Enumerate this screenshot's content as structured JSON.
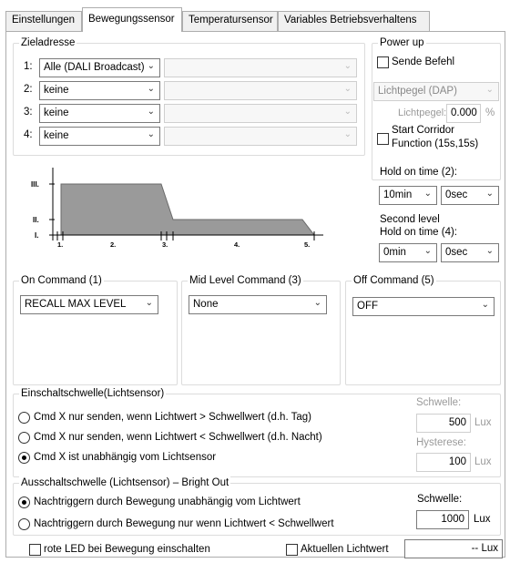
{
  "tabs": [
    {
      "label": "Einstellungen",
      "active": false
    },
    {
      "label": "Bewegungssensor",
      "active": true
    },
    {
      "label": "Temperatursensor",
      "active": false
    },
    {
      "label": "Variables Betriebsverhaltens",
      "active": false
    }
  ],
  "zieladresse": {
    "title": "Zieladresse",
    "rows": [
      {
        "index": "1:",
        "value": "Alle (DALI Broadcast)"
      },
      {
        "index": "2:",
        "value": "keine"
      },
      {
        "index": "3:",
        "value": "keine"
      },
      {
        "index": "4:",
        "value": "keine"
      }
    ]
  },
  "power_up": {
    "title": "Power up",
    "sende_befehl": "Sende Befehl",
    "lichtpegel_select": "Lichtpegel (DAP)",
    "lichtpegel_label": "Lichtpegel:",
    "lichtpegel_value": "0.000",
    "lichtpegel_unit": "%",
    "corridor_line1": "Start Corridor",
    "corridor_line2": "Function (15s,15s)"
  },
  "graph": {
    "level_labels": [
      "III.",
      "II.",
      "I."
    ],
    "phase_labels": [
      "1.",
      "2.",
      "3.",
      "4.",
      "5."
    ]
  },
  "hold_time": {
    "label": "Hold on time (2):",
    "min": "10min",
    "sec": "0sec",
    "second_level_line1": "Second level",
    "second_level_line2": "Hold on time (4):",
    "min2": "0min",
    "sec2": "0sec"
  },
  "on_command": {
    "title": "On Command (1)",
    "value": "RECALL MAX LEVEL"
  },
  "mid_command": {
    "title": "Mid Level Command (3)",
    "value": "None"
  },
  "off_command": {
    "title": "Off Command (5)",
    "value": "OFF"
  },
  "einschalt": {
    "title": "Einschaltschwelle(Lichtsensor)",
    "options": [
      {
        "label": "Cmd X nur senden, wenn Lichtwert > Schwellwert (d.h. Tag)",
        "selected": false
      },
      {
        "label": "Cmd X nur senden, wenn Lichtwert < Schwellwert (d.h. Nacht)",
        "selected": false
      },
      {
        "label": "Cmd X ist unabhängig vom Lichtsensor",
        "selected": true
      }
    ],
    "schwelle_label": "Schwelle:",
    "schwelle_value": "500",
    "schwelle_unit": "Lux",
    "hysterese_label": "Hysterese:",
    "hysterese_value": "100",
    "hysterese_unit": "Lux"
  },
  "ausschalt": {
    "title": "Ausschaltschwelle (Lichtsensor) – Bright Out",
    "options": [
      {
        "label": "Nachtriggern durch Bewegung unabhängig vom Lichtwert",
        "selected": true
      },
      {
        "label": "Nachtriggern durch Bewegung nur wenn Lichtwert < Schwellwert",
        "selected": false
      }
    ],
    "schwelle_label": "Schwelle:",
    "schwelle_value": "1000",
    "schwelle_unit": "Lux"
  },
  "bottom": {
    "rote_led": "rote LED bei Bewegung einschalten",
    "aktuellen": "Aktuellen Lichtwert",
    "lux_display": "-- Lux"
  }
}
